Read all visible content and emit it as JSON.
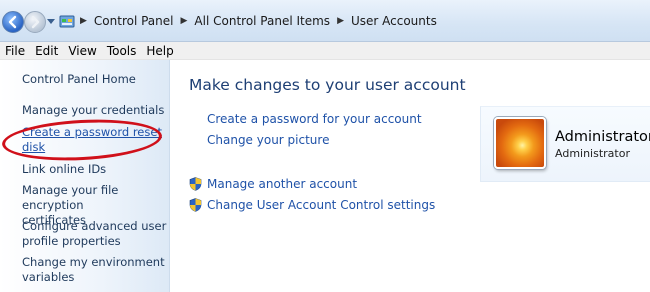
{
  "breadcrumb": [
    "Control Panel",
    "All Control Panel Items",
    "User Accounts"
  ],
  "menu": [
    "File",
    "Edit",
    "View",
    "Tools",
    "Help"
  ],
  "left_pane": {
    "home": "Control Panel Home",
    "credentials": "Manage your credentials",
    "reset_disk_line1": "Create a password reset",
    "reset_disk_line2": "disk",
    "online_ids": "Link online IDs",
    "encryption_line1": "Manage your file encryption",
    "encryption_line2": "certificates",
    "advanced_line1": "Configure advanced user",
    "advanced_line2": "profile properties",
    "environment_line1": "Change my environment",
    "environment_line2": "variables"
  },
  "main": {
    "title": "Make changes to your user account",
    "create_password": "Create a password for your account",
    "change_picture": "Change your picture",
    "manage_another": "Manage another account",
    "uac_settings": "Change User Account Control settings"
  },
  "user": {
    "name": "Administrator",
    "role": "Administrator"
  },
  "colors": {
    "link": "#1f52a8",
    "title": "#1e3f74",
    "annotation": "#d0101a"
  }
}
